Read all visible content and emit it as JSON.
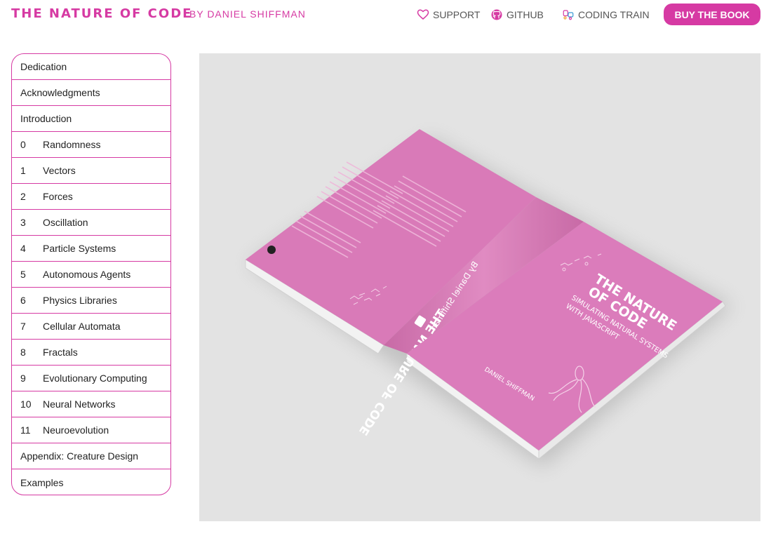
{
  "header": {
    "title": "THE NATURE OF CODE",
    "byline": "BY DANIEL SHIFFMAN",
    "nav": {
      "support": "SUPPORT",
      "github": "GITHUB",
      "coding_train": "CODING TRAIN"
    },
    "buy_label": "BUY THE BOOK"
  },
  "toc": [
    {
      "num": "",
      "label": "Dedication"
    },
    {
      "num": "",
      "label": "Acknowledgments"
    },
    {
      "num": "",
      "label": "Introduction"
    },
    {
      "num": "0",
      "label": "Randomness"
    },
    {
      "num": "1",
      "label": "Vectors"
    },
    {
      "num": "2",
      "label": "Forces"
    },
    {
      "num": "3",
      "label": "Oscillation"
    },
    {
      "num": "4",
      "label": "Particle Systems"
    },
    {
      "num": "5",
      "label": "Autonomous Agents"
    },
    {
      "num": "6",
      "label": "Physics Libraries"
    },
    {
      "num": "7",
      "label": "Cellular Automata"
    },
    {
      "num": "8",
      "label": "Fractals"
    },
    {
      "num": "9",
      "label": "Evolutionary Computing"
    },
    {
      "num": "10",
      "label": "Neural Networks"
    },
    {
      "num": "11",
      "label": "Neuroevolution"
    },
    {
      "num": "",
      "label": "Appendix: Creature Design"
    },
    {
      "num": "",
      "label": "Examples"
    }
  ],
  "book": {
    "cover_title_line1": "THE NATURE",
    "cover_title_line2": "OF CODE",
    "cover_subtitle_line1": "SIMULATING NATURAL SYSTEMS",
    "cover_subtitle_line2": "WITH JAVASCRIPT",
    "cover_author": "DANIEL SHIFFMAN",
    "spine_title": "THE NATURE OF CODE",
    "spine_author": "By Daniel Shiffman"
  },
  "colors": {
    "accent": "#d63aa3",
    "book_pink": "#d97ab8",
    "hero_bg": "#e3e3e3"
  }
}
